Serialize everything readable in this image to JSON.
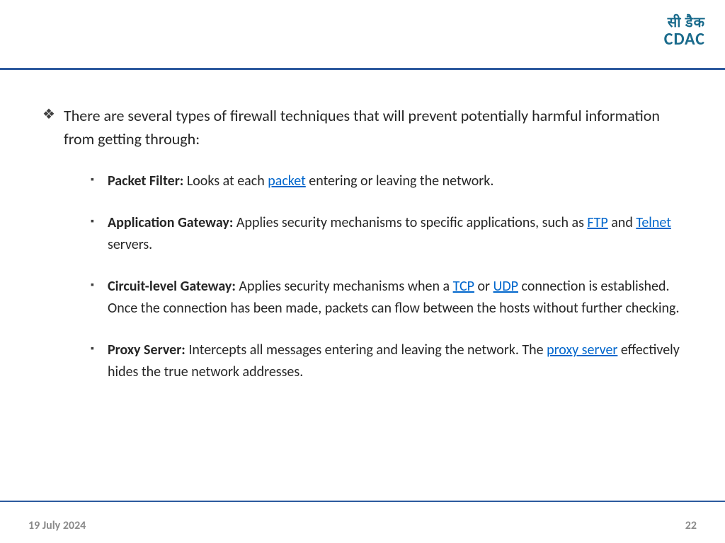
{
  "logo": {
    "hindi": "सी डैक",
    "en": "CDAC"
  },
  "intro": "There are several types of firewall techniques that will prevent potentially harmful information from getting through:",
  "items": {
    "pf": {
      "label": "Packet Filter:",
      "t1": " Looks at each ",
      "link1": "packet",
      "t2": " entering or leaving the network."
    },
    "ag": {
      "label": "Application Gateway:",
      "t1": " Applies security mechanisms to specific applications, such as ",
      "link1": "FTP",
      "t2": " and ",
      "link2": "Telnet",
      "t3": " servers."
    },
    "cg": {
      "label": "Circuit-level Gateway:",
      "t1": " Applies security mechanisms when a ",
      "link1": "TCP",
      "t2": " or ",
      "link2": "UDP",
      "t3": " connection is established. Once the connection has been made, packets can flow between the hosts without further checking."
    },
    "ps": {
      "label": "Proxy Server:",
      "t1": " Intercepts all messages entering and leaving the network. The ",
      "link1": "proxy server",
      "t2": " effectively hides the true network addresses."
    }
  },
  "footer": {
    "date": "19 July 2024",
    "page": "22"
  }
}
